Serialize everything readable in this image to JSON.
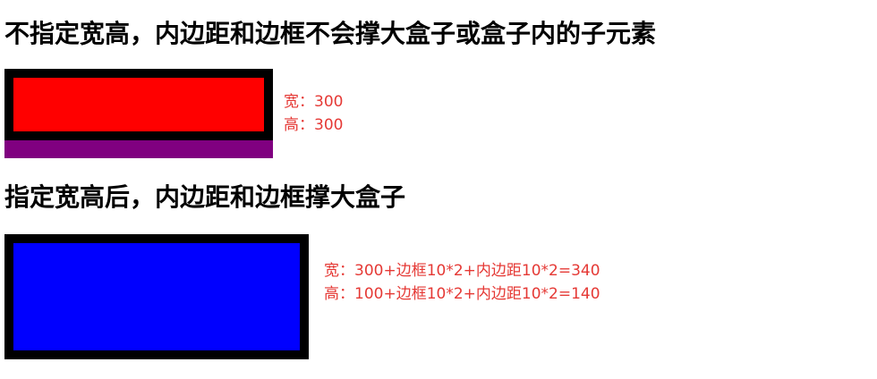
{
  "sections": [
    {
      "heading": "不指定宽高，内边距和边框不会撑大盒子或盒子内的子元素",
      "notes": {
        "width": "宽：300",
        "height": "高：300"
      },
      "colors": {
        "outer": "#800080",
        "border": "#000000",
        "inner": "#ff0000"
      }
    },
    {
      "heading": "指定宽高后，内边距和边框撑大盒子",
      "notes": {
        "width": "宽：300+边框10*2+内边距10*2=340",
        "height": "高：100+边框10*2+内边距10*2=140"
      },
      "colors": {
        "border": "#000000",
        "inner": "#0000ff"
      }
    }
  ],
  "text_color": "#e53935"
}
